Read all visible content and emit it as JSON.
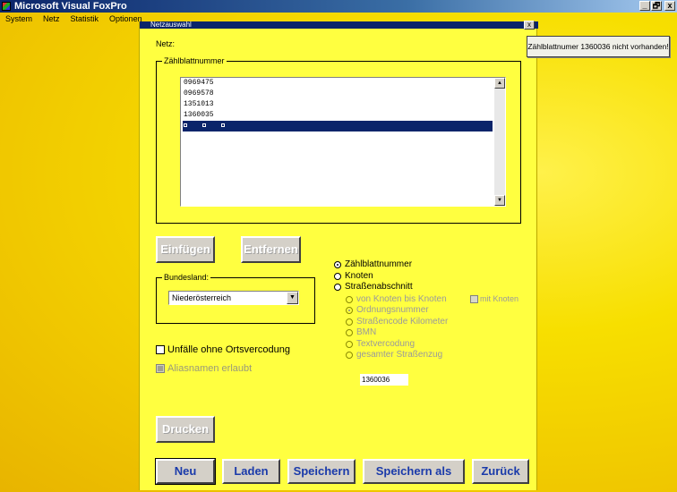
{
  "window": {
    "title": "Microsoft Visual FoxPro",
    "min_glyph": "_",
    "max_glyph": "🗗",
    "close_glyph": "x"
  },
  "menu": [
    "System",
    "Netz",
    "Statistik",
    "Optionen"
  ],
  "dialog": {
    "title": "Netzauswahl",
    "close_glyph": "x",
    "netz_label": "Netz:",
    "zaehlblatt_group": {
      "caption": "Zählblattnummer",
      "items": [
        "0969475",
        "0969578",
        "1351013",
        "1360035"
      ],
      "selected_index": 4
    },
    "buttons": {
      "einfuegen": "Einfügen",
      "entfernen": "Entfernen",
      "drucken": "Drucken",
      "neu": "Neu",
      "laden": "Laden",
      "speichern": "Speichern",
      "speichern_als": "Speichern als",
      "zurueck": "Zurück"
    },
    "bundesland": {
      "caption": "Bundesland:",
      "selected": "Niederösterreich",
      "arrow_glyph": "▼"
    },
    "checkboxes": {
      "unfaelle": "Unfälle ohne Ortsvercodung",
      "aliasnamen": "Aliasnamen erlaubt",
      "mit_knoten": "mit Knoten"
    },
    "radio_main": [
      {
        "label": "Zählblattnummer",
        "checked": true
      },
      {
        "label": "Knoten",
        "checked": false
      },
      {
        "label": "Straßenabschnitt",
        "checked": false
      }
    ],
    "radio_sub": [
      {
        "label": "von Knoten bis Knoten",
        "checked": false
      },
      {
        "label": "Ordnungsnummer",
        "checked": true
      },
      {
        "label": "Straßencode Kilometer",
        "checked": false
      },
      {
        "label": "BMN",
        "checked": false
      },
      {
        "label": "Textvercodung",
        "checked": false
      },
      {
        "label": "gesamter Straßenzug",
        "checked": false
      }
    ],
    "input_value": "1360036"
  },
  "message": "Zählblattnumer 1360036 nicht vorhanden!",
  "colors": {
    "desktop": "#f7df00",
    "dialog_bg": "#ffff40",
    "selection": "#0a246a",
    "titlebar": "#0a246a"
  }
}
